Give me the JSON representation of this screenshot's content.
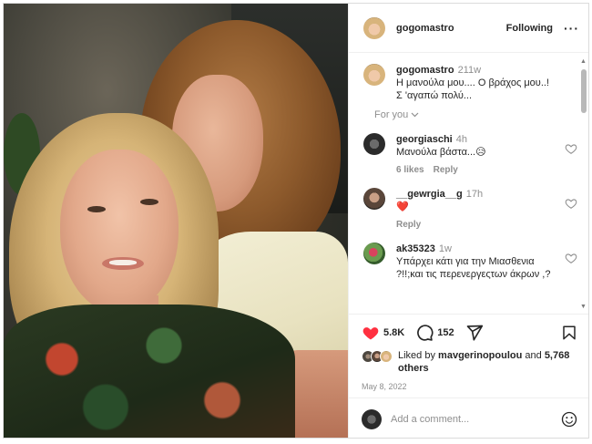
{
  "post": {
    "author": "gogomastro",
    "follow_label": "Following",
    "caption_author": "gogomastro",
    "caption_age": "211w",
    "caption_text": "Η μανούλα μου.... Ο βράχος μου..! Σ 'αγαπώ πολύ...",
    "for_you_label": "For you"
  },
  "comments": [
    {
      "username": "georgiaschi",
      "age": "4h",
      "text": "Μανούλα βάστα...😥",
      "likes": "6 likes",
      "reply": "Reply"
    },
    {
      "username": "__gewrgia__g",
      "age": "17h",
      "text": "❤️",
      "likes": "",
      "reply": "Reply"
    },
    {
      "username": "ak35323",
      "age": "1w",
      "text": "Υπάρχει κάτι για την Μιασθενια ?!!;και τις περενεργεςτων άκρων ,?",
      "likes": "",
      "reply": ""
    }
  ],
  "stats": {
    "likes_count": "5.8K",
    "comments_count": "152",
    "liked_by_prefix": "Liked by",
    "liked_by_user": "mavgerinopoulou",
    "liked_by_and": "and",
    "liked_by_others": "5,768 others",
    "date": "May 8, 2022"
  },
  "composer": {
    "placeholder": "Add a comment..."
  },
  "colors": {
    "like_red": "#ff3040",
    "muted": "#8e8e8e",
    "text": "#262626"
  }
}
